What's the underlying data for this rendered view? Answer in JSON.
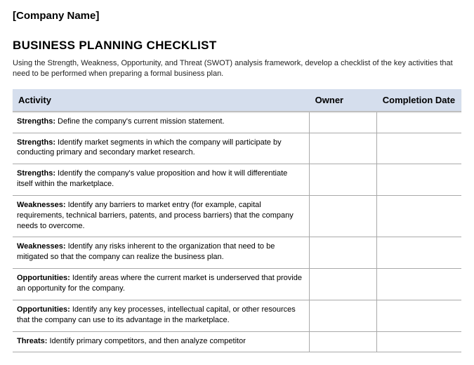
{
  "company_name": "[Company Name]",
  "title": "BUSINESS PLANNING CHECKLIST",
  "intro": "Using the Strength, Weakness, Opportunity, and Threat (SWOT) analysis framework, develop a checklist of the key activities that need to be performed when preparing a formal business plan.",
  "columns": {
    "activity": "Activity",
    "owner": "Owner",
    "completion_date": "Completion Date"
  },
  "rows": [
    {
      "category": "Strengths:",
      "text": " Define the company's current mission statement.",
      "owner": "",
      "date": ""
    },
    {
      "category": "Strengths:",
      "text": " Identify market segments in which the company will participate by conducting primary and secondary market research.",
      "owner": "",
      "date": ""
    },
    {
      "category": "Strengths:",
      "text": " Identify the company's value proposition and how it will differentiate itself within the marketplace.",
      "owner": "",
      "date": ""
    },
    {
      "category": "Weaknesses:",
      "text": " Identify any barriers to market entry (for example, capital requirements, technical barriers, patents, and process barriers) that the company needs to overcome.",
      "owner": "",
      "date": ""
    },
    {
      "category": "Weaknesses:",
      "text": " Identify any risks inherent to the organization that need to be mitigated so that the company can realize the business plan.",
      "owner": "",
      "date": ""
    },
    {
      "category": "Opportunities:",
      "text": " Identify areas where the current market is underserved that provide an opportunity for the company.",
      "owner": "",
      "date": ""
    },
    {
      "category": "Opportunities:",
      "text": " Identify any key processes, intellectual capital, or other resources that the company can use to its advantage in the marketplace.",
      "owner": "",
      "date": ""
    },
    {
      "category": "Threats:",
      "text": " Identify primary competitors, and then analyze competitor",
      "owner": "",
      "date": ""
    }
  ]
}
